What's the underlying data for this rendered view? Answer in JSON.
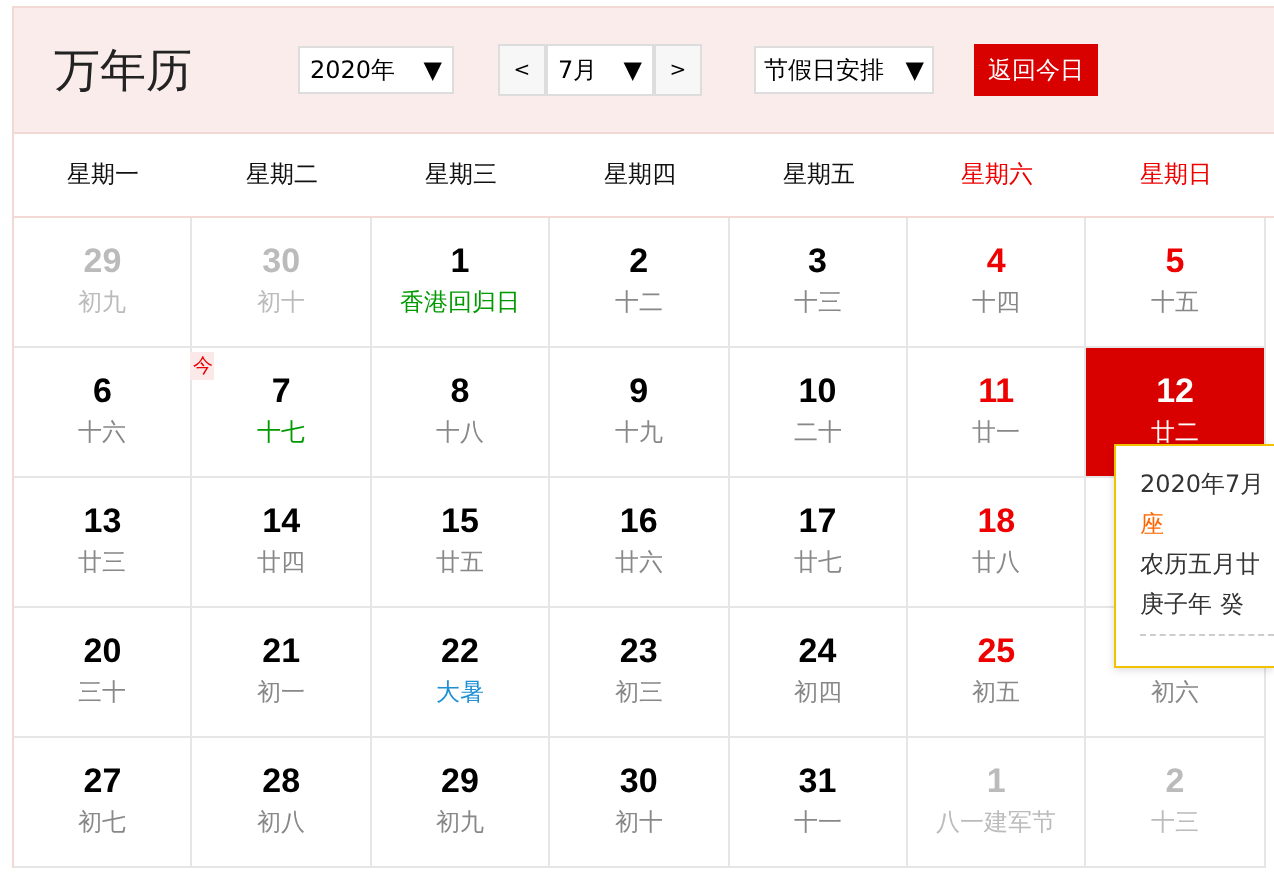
{
  "title": "万年历",
  "controls": {
    "year": "2020年",
    "year_arrow": "▼",
    "prev": "<",
    "month": "7月",
    "month_arrow": "▼",
    "next": ">",
    "holiday": "节假日安排",
    "holiday_arrow": "▼",
    "today_button": "返回今日"
  },
  "weekdays": [
    {
      "label": "星期一",
      "weekend": false
    },
    {
      "label": "星期二",
      "weekend": false
    },
    {
      "label": "星期三",
      "weekend": false
    },
    {
      "label": "星期四",
      "weekend": false
    },
    {
      "label": "星期五",
      "weekend": false
    },
    {
      "label": "星期六",
      "weekend": true
    },
    {
      "label": "星期日",
      "weekend": true
    }
  ],
  "weeks": [
    [
      {
        "day": "29",
        "lunar": "初九",
        "other_month": true,
        "selected": false
      },
      {
        "day": "30",
        "lunar": "初十",
        "other_month": true,
        "selected": false
      },
      {
        "day": "1",
        "lunar": "香港回归日",
        "other_month": false,
        "kind": "festival",
        "selected": false
      },
      {
        "day": "2",
        "lunar": "十二",
        "other_month": false,
        "kind": "plain",
        "selected": false
      },
      {
        "day": "3",
        "lunar": "十三",
        "other_month": false,
        "kind": "plain",
        "selected": false
      },
      {
        "day": "4",
        "lunar": "十四",
        "other_month": false,
        "kind": "plain",
        "selected": false
      },
      {
        "day": "5",
        "lunar": "十五",
        "other_month": false,
        "kind": "plain",
        "selected": false
      }
    ],
    [
      {
        "day": "6",
        "lunar": "十六",
        "other_month": false,
        "kind": "plain",
        "selected": false
      },
      {
        "day": "7",
        "lunar": "十七",
        "other_month": false,
        "kind": "festival",
        "selected": false,
        "today_mark": "今"
      },
      {
        "day": "8",
        "lunar": "十八",
        "other_month": false,
        "kind": "plain",
        "selected": false
      },
      {
        "day": "9",
        "lunar": "十九",
        "other_month": false,
        "kind": "plain",
        "selected": false
      },
      {
        "day": "10",
        "lunar": "二十",
        "other_month": false,
        "kind": "plain",
        "selected": false
      },
      {
        "day": "11",
        "lunar": "廿一",
        "other_month": false,
        "kind": "plain",
        "selected": false
      },
      {
        "day": "12",
        "lunar": "廿二",
        "other_month": false,
        "kind": "plain",
        "selected": true
      }
    ],
    [
      {
        "day": "13",
        "lunar": "廿三",
        "other_month": false,
        "kind": "plain",
        "selected": false
      },
      {
        "day": "14",
        "lunar": "廿四",
        "other_month": false,
        "kind": "plain",
        "selected": false
      },
      {
        "day": "15",
        "lunar": "廿五",
        "other_month": false,
        "kind": "plain",
        "selected": false
      },
      {
        "day": "16",
        "lunar": "廿六",
        "other_month": false,
        "kind": "plain",
        "selected": false
      },
      {
        "day": "17",
        "lunar": "廿七",
        "other_month": false,
        "kind": "plain",
        "selected": false
      },
      {
        "day": "18",
        "lunar": "廿八",
        "other_month": false,
        "kind": "plain",
        "selected": false
      },
      {
        "selected": false
      }
    ],
    [
      {
        "day": "20",
        "lunar": "三十",
        "other_month": false,
        "kind": "plain",
        "selected": false
      },
      {
        "day": "21",
        "lunar": "初一",
        "other_month": false,
        "kind": "plain",
        "selected": false
      },
      {
        "day": "22",
        "lunar": "大暑",
        "other_month": false,
        "kind": "term",
        "selected": false
      },
      {
        "day": "23",
        "lunar": "初三",
        "other_month": false,
        "kind": "plain",
        "selected": false
      },
      {
        "day": "24",
        "lunar": "初四",
        "other_month": false,
        "kind": "plain",
        "selected": false
      },
      {
        "day": "25",
        "lunar": "初五",
        "other_month": false,
        "kind": "plain",
        "selected": false
      },
      {
        "lunar": "初六",
        "other_month": false,
        "kind": "plain",
        "selected": false
      }
    ],
    [
      {
        "day": "27",
        "lunar": "初七",
        "other_month": false,
        "kind": "plain",
        "selected": false
      },
      {
        "day": "28",
        "lunar": "初八",
        "other_month": false,
        "kind": "plain",
        "selected": false
      },
      {
        "day": "29",
        "lunar": "初九",
        "other_month": false,
        "kind": "plain",
        "selected": false
      },
      {
        "day": "30",
        "lunar": "初十",
        "other_month": false,
        "kind": "plain",
        "selected": false
      },
      {
        "day": "31",
        "lunar": "十一",
        "other_month": false,
        "kind": "plain",
        "selected": false
      },
      {
        "day": "1",
        "lunar": "八一建军节",
        "other_month": true,
        "selected": false
      },
      {
        "day": "2",
        "lunar": "十三",
        "other_month": true,
        "selected": false
      }
    ]
  ],
  "tooltip": {
    "date": "2020年7月",
    "sign": "座",
    "lunar": "农历五月廿",
    "ganzhi": "庚子年 癸"
  }
}
